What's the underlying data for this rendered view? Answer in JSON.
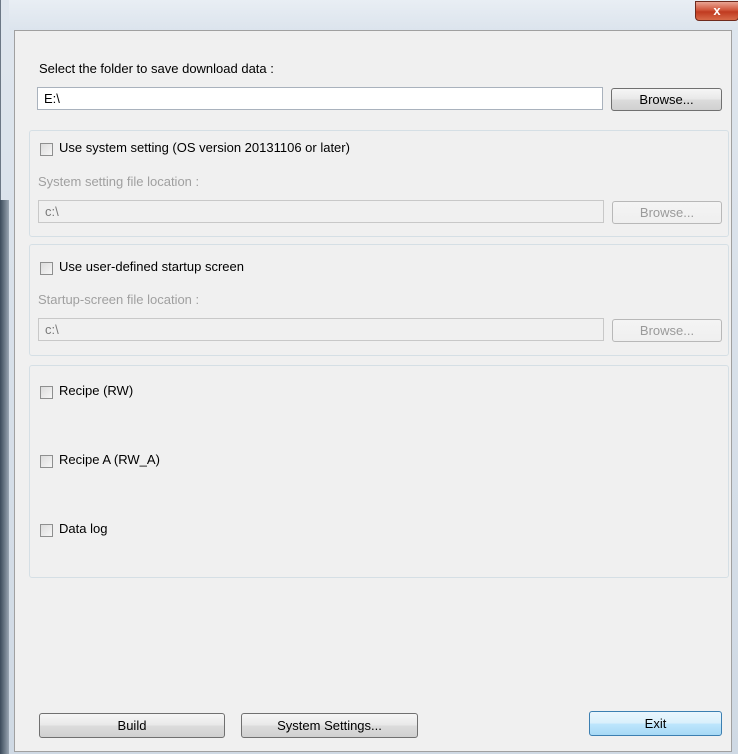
{
  "window": {
    "close_glyph": "x"
  },
  "download": {
    "folder_label": "Select the folder to save download data :",
    "folder_value": "E:\\",
    "browse_label": "Browse..."
  },
  "system_setting": {
    "checkbox_label": "Use system setting (OS version 20131106 or later)",
    "checked": false,
    "file_label": "System setting file location :",
    "file_value": "c:\\",
    "browse_label": "Browse..."
  },
  "startup_screen": {
    "checkbox_label": "Use user-defined startup screen",
    "checked": false,
    "file_label": "Startup-screen file location :",
    "file_value": "c:\\",
    "browse_label": "Browse..."
  },
  "options": [
    {
      "label": "Recipe (RW)",
      "checked": false
    },
    {
      "label": "Recipe A (RW_A)",
      "checked": false
    },
    {
      "label": "Data log",
      "checked": false
    }
  ],
  "footer": {
    "build_label": "Build",
    "system_settings_label": "System Settings...",
    "exit_label": "Exit"
  },
  "colors": {
    "close_button": "#c7432a",
    "client_bg": "#f0f0f0",
    "disabled_text": "#a0a0a0"
  }
}
